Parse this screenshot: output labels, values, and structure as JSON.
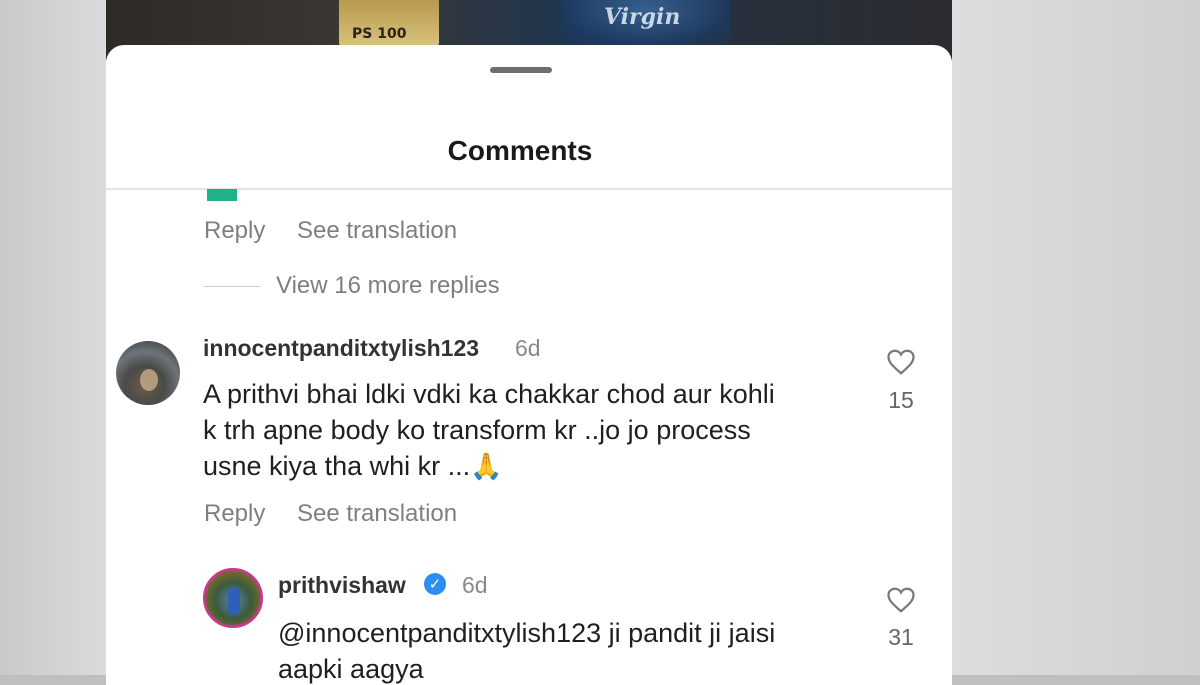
{
  "video": {
    "price_tag": "PS 100",
    "brand": "Virgin"
  },
  "sheet": {
    "title": "Comments"
  },
  "prev_comment": {
    "reply_label": "Reply",
    "translate_label": "See translation",
    "view_replies": "View 16 more replies"
  },
  "comment": {
    "username": "innocentpanditxtylish123",
    "time": "6d",
    "text_line1": "A prithvi bhai ldki vdki ka chakkar chod aur kohli",
    "text_line2": "k trh apne body ko transform kr ..jo jo process",
    "text_line3": "usne kiya tha whi kr ...",
    "emoji": "🙏",
    "likes": "15",
    "reply_label": "Reply",
    "translate_label": "See translation"
  },
  "reply": {
    "username": "prithvishaw",
    "verified": "✓",
    "time": "6d",
    "text_line1": "@innocentpanditxtylish123 ji pandit ji jaisi",
    "text_line2": "aapki aagya",
    "likes": "31"
  },
  "colors": {
    "verified_blue": "#2c8ef0",
    "story_ring": "#c23a8c",
    "muted_text": "#7f7f7f"
  }
}
